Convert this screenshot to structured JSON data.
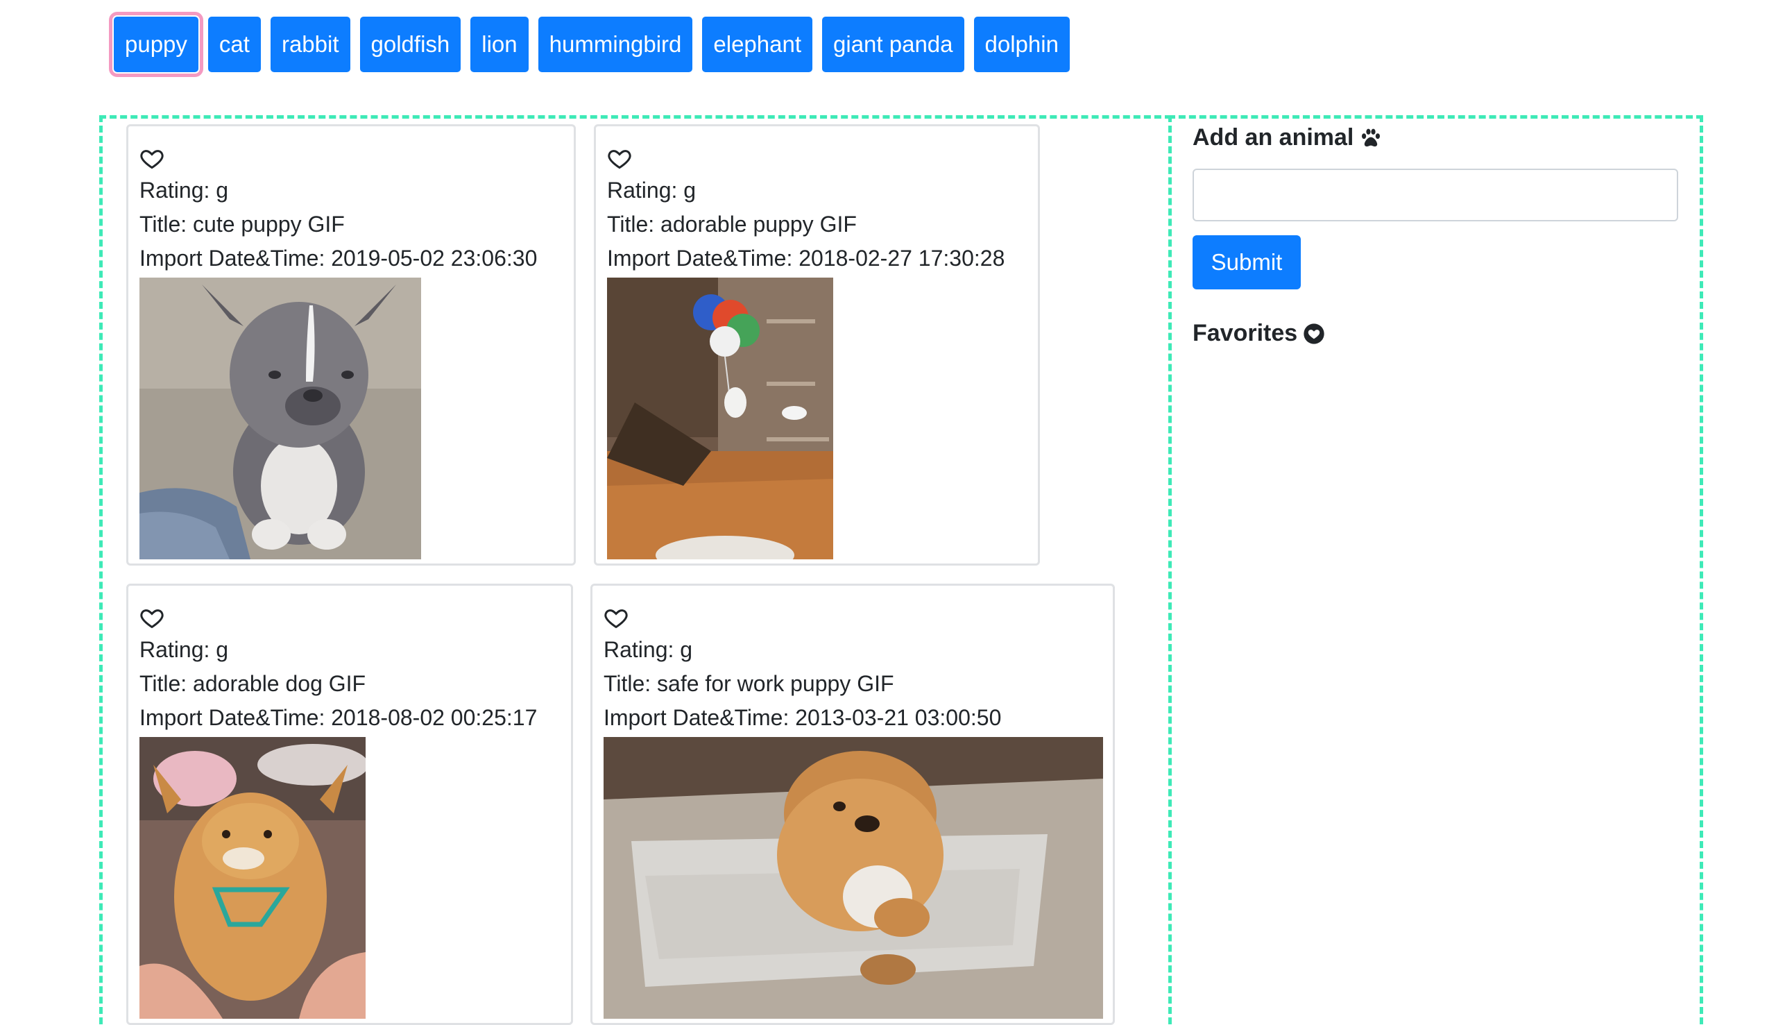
{
  "topics": [
    "puppy",
    "cat",
    "rabbit",
    "goldfish",
    "lion",
    "hummingbird",
    "elephant",
    "giant panda",
    "dolphin"
  ],
  "active_topic": "puppy",
  "gifs": [
    {
      "rating": "Rating: g",
      "title": "Title: cute puppy GIF",
      "import": "Import Date&Time: 2019-05-02 23:06:30",
      "image": "gray puppy sitting on rug"
    },
    {
      "rating": "Rating: g",
      "title": "Title: adorable puppy GIF",
      "import": "Import Date&Time: 2018-02-27 17:30:28",
      "image": "white puppy near balloons in hallway"
    },
    {
      "rating": "Rating: g",
      "title": "Title: adorable dog GIF",
      "import": "Import Date&Time: 2018-08-02 00:25:17",
      "image": "dog lying on back getting belly rub"
    },
    {
      "rating": "Rating: g",
      "title": "Title: safe for work puppy GIF",
      "import": "Import Date&Time: 2013-03-21 03:00:50",
      "image": "fluffy puppy playing with towel"
    }
  ],
  "form": {
    "title": "Add an animal",
    "input_value": "",
    "submit_label": "Submit",
    "favorites_title": "Favorites"
  },
  "colors": {
    "button": "#0d7dff",
    "active_outline": "#f49ac1",
    "dashed_border": "#3eeab7"
  }
}
